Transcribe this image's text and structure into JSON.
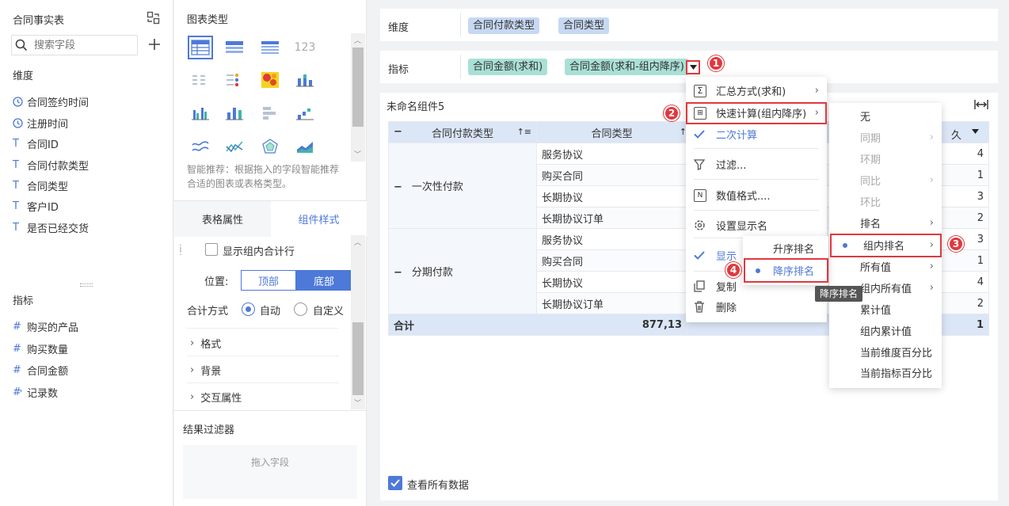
{
  "left": {
    "title": "合同事实表",
    "search_placeholder": "搜索字段",
    "dim_section": "维度",
    "dimensions": [
      "合同签约时间",
      "注册时间",
      "合同ID",
      "合同付款类型",
      "合同类型",
      "客户ID",
      "是否已经交货"
    ],
    "metric_section": "指标",
    "metrics": [
      "购买的产品",
      "购买数量",
      "合同金额",
      "记录数"
    ]
  },
  "middle": {
    "chart_type_title": "图表类型",
    "smart_hint": "智能推荐：根据拖入的字段智能推荐合适的图表或表格类型。",
    "tab_table": "表格属性",
    "tab_style": "组件样式",
    "show_subtotal": "显示组内合计行",
    "position_label": "位置:",
    "pos_top": "顶部",
    "pos_bottom": "底部",
    "sum_label": "合计方式",
    "sum_auto": "自动",
    "sum_custom": "自定义",
    "sec_format": "格式",
    "sec_bg": "背景",
    "sec_interact": "交互属性",
    "filter_title": "结果过滤器",
    "drop_hint": "拖入字段"
  },
  "main": {
    "dim_label": "维度",
    "dim_pills": [
      "合同付款类型",
      "合同类型"
    ],
    "metric_label": "指标",
    "metric_pills": [
      "合同金额(求和)",
      "合同金额(求和-组内降序)"
    ],
    "widget_title": "未命名组件5",
    "table": {
      "h1": "合同付款类型",
      "h2": "合同类型",
      "h3_partial": "久",
      "groups": [
        {
          "name": "一次性付款",
          "rows": [
            {
              "type": "服务协议",
              "rank": "4"
            },
            {
              "type": "购买合同",
              "rank": "1"
            },
            {
              "type": "长期协议",
              "rank": "3"
            },
            {
              "type": "长期协议订单",
              "rank": "2"
            }
          ]
        },
        {
          "name": "分期付款",
          "rows": [
            {
              "type": "服务协议",
              "rank": "3"
            },
            {
              "type": "购买合同",
              "rank": "1"
            },
            {
              "type": "长期协议",
              "rank": "4"
            },
            {
              "type": "长期协议订单",
              "rank": "2"
            }
          ]
        }
      ],
      "total_label": "合计",
      "total_value": "877,13",
      "total_rank": "1"
    },
    "view_all": "查看所有数据"
  },
  "menu1": {
    "items": [
      "汇总方式(求和)",
      "快速计算(组内降序)",
      "二次计算",
      "过滤...",
      "数值格式....",
      "设置显示名",
      "显示",
      "复制",
      "删除"
    ]
  },
  "menu2": {
    "items": [
      "无",
      "同期",
      "环期",
      "同比",
      "环比",
      "排名",
      "组内排名",
      "所有值",
      "组内所有值",
      "累计值",
      "组内累计值",
      "当前维度百分比",
      "当前指标百分比"
    ]
  },
  "menu3": {
    "asc": "升序排名",
    "desc": "降序排名"
  },
  "tooltip": "降序排名",
  "badges": [
    "1",
    "2",
    "3",
    "4"
  ],
  "colors": {
    "accent": "#4d79d8",
    "badge": "#e0393e"
  }
}
